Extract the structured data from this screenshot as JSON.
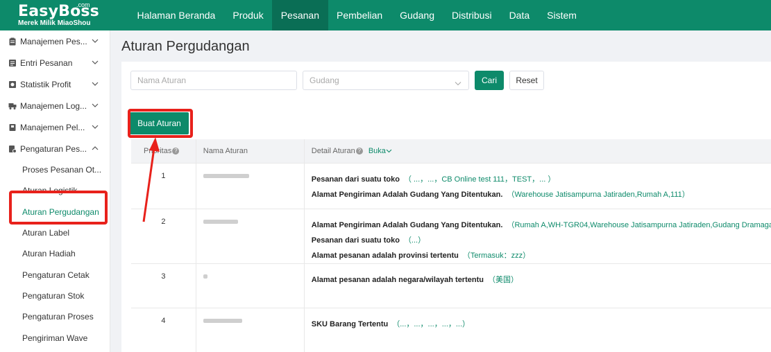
{
  "logo": {
    "main": "EasyBoss",
    "com": ".com",
    "sub": "Merek Milik MiaoShou"
  },
  "nav": [
    "Halaman Beranda",
    "Produk",
    "Pesanan",
    "Pembelian",
    "Gudang",
    "Distribusi",
    "Data",
    "Sistem"
  ],
  "nav_active": "Pesanan",
  "sidebar": {
    "groups": [
      {
        "label": "Manajemen Pes...",
        "icon": "clipboard-icon",
        "chevron": "down"
      },
      {
        "label": "Entri Pesanan",
        "icon": "list-icon",
        "chevron": "down"
      },
      {
        "label": "Statistik Profit",
        "icon": "chart-icon",
        "chevron": "down"
      },
      {
        "label": "Manajemen Log...",
        "icon": "truck-icon",
        "chevron": "down"
      },
      {
        "label": "Manajemen Pel...",
        "icon": "document-icon",
        "chevron": "down"
      },
      {
        "label": "Pengaturan Pes...",
        "icon": "settings-doc-icon",
        "chevron": "up"
      }
    ],
    "subitems": [
      "Proses Pesanan Ot...",
      "Aturan Logistik",
      "Aturan Pergudangan",
      "Aturan Label",
      "Aturan Hadiah",
      "Pengaturan Cetak",
      "Pengaturan Stok",
      "Pengaturan Proses",
      "Pengiriman Wave"
    ],
    "active_subitem": "Aturan Pergudangan"
  },
  "page": {
    "title": "Aturan Pergudangan"
  },
  "filter": {
    "name_placeholder": "Nama Aturan",
    "warehouse_placeholder": "Gudang",
    "search_label": "Cari",
    "reset_label": "Reset"
  },
  "create_button": "Buat Aturan",
  "table": {
    "headers": {
      "priority": "Prioritas",
      "name": "Nama Aturan",
      "detail": "Detail Aturan",
      "expand": "Buka"
    },
    "rows": [
      {
        "priority": "1",
        "details": [
          {
            "label": "Pesanan dari suatu toko",
            "value": "（ ...，...，CB Online test 111，TEST，... ）"
          },
          {
            "label": "Alamat Pengiriman Adalah Gudang Yang Ditentukan.",
            "value": "（Warehouse Jatisampurna Jatiraden,Rumah A,111）"
          }
        ]
      },
      {
        "priority": "2",
        "details": [
          {
            "label": "Alamat Pengiriman Adalah Gudang Yang Ditentukan.",
            "value": "（Rumah A,WH-TGR04,Warehouse Jatisampurna Jatiraden,Gudang Dramaga"
          },
          {
            "label": "Pesanan dari suatu toko",
            "value": "（...）"
          },
          {
            "label": "Alamat pesanan adalah provinsi tertentu",
            "value": "（Termasuk：zzz）"
          }
        ]
      },
      {
        "priority": "3",
        "details": [
          {
            "label": "Alamat pesanan adalah negara/wilayah tertentu",
            "value": "（美国）"
          }
        ]
      },
      {
        "priority": "4",
        "details": [
          {
            "label": "SKU Barang Tertentu",
            "value": "（...，...，...，...，...）"
          }
        ]
      }
    ]
  },
  "colors": {
    "brand": "#0d8a6a",
    "brand_dark": "#0a6e55",
    "annotation_red": "#e8211b"
  }
}
